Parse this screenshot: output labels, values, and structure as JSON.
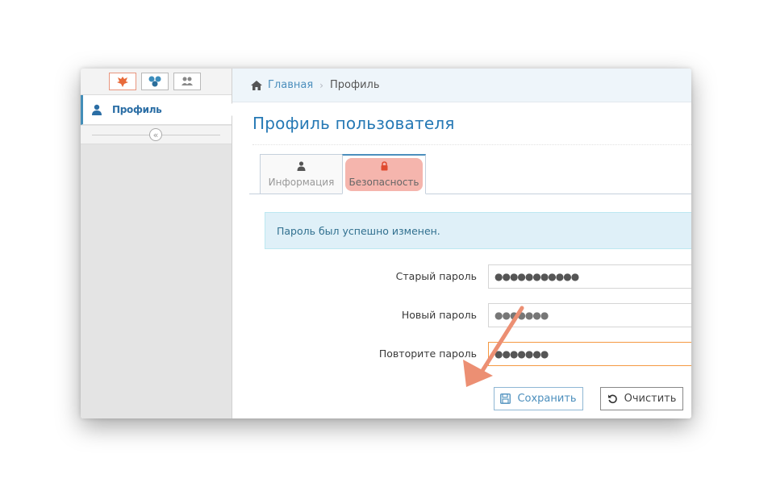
{
  "sidebar": {
    "shortcuts": [
      {
        "icon": "emblem-icon"
      },
      {
        "icon": "network-icon"
      },
      {
        "icon": "users-icon"
      }
    ],
    "items": [
      {
        "label": "Профиль",
        "icon": "user-icon"
      }
    ],
    "collapse_icon": "double-chevron-left-icon"
  },
  "breadcrumbs": {
    "home": "Главная",
    "current": "Профиль"
  },
  "page": {
    "title": "Профиль пользователя"
  },
  "tabs": [
    {
      "label": "Информация",
      "icon": "user-icon"
    },
    {
      "label": "Безопасность",
      "icon": "lock-icon",
      "active": true
    }
  ],
  "alert": {
    "message": "Пароль был успешно изменен."
  },
  "form": {
    "old_password": {
      "label": "Старый пароль",
      "value": "●●●●●●●●●●●"
    },
    "new_password": {
      "label": "Новый пароль",
      "value": "●●●●●●●"
    },
    "repeat_password": {
      "label": "Повторите пароль",
      "value": "●●●●●●●"
    }
  },
  "buttons": {
    "save": "Сохранить",
    "clear": "Очистить"
  },
  "colors": {
    "accent": "#2679b5",
    "link": "#4c8fbd",
    "highlight": "#f5b5ad",
    "arrow": "#ec8f73"
  }
}
